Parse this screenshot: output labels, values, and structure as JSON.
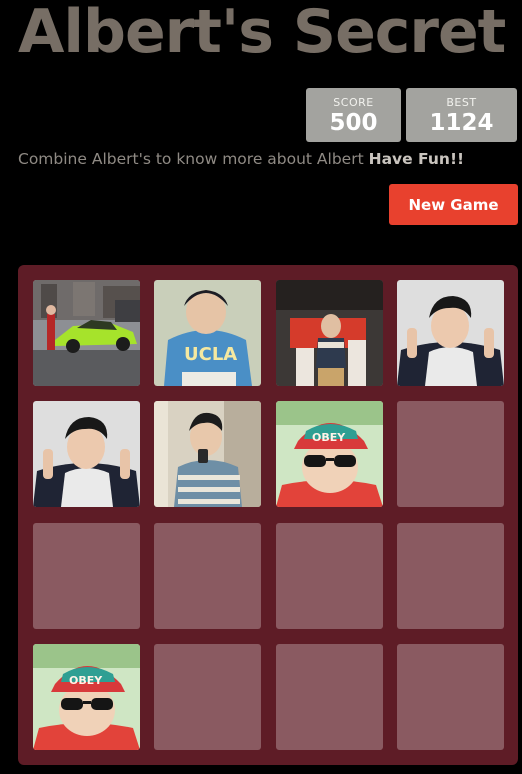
{
  "header": {
    "title": "Albert's Secret"
  },
  "scores": {
    "score_label": "SCORE",
    "score_value": "500",
    "best_label": "BEST",
    "best_value": "1124"
  },
  "intro": {
    "text": "Combine Albert's to know more about Albert ",
    "emphasis": "Have Fun!!"
  },
  "controls": {
    "new_game_label": "New Game"
  },
  "colors": {
    "background": "#000000",
    "title": "#776e65",
    "score_box": "#a3a39f",
    "new_game_button": "#e8412e",
    "board": "#5e1c26",
    "empty_cell": "#8a5a61"
  },
  "board": {
    "size": 4,
    "rows": [
      [
        "photo-sports-car",
        "photo-ucla-hoodie",
        "photo-ted-stage",
        "photo-selfie-hoodie"
      ],
      [
        "photo-selfie-hoodie",
        "photo-mirror-selfie",
        "photo-obey-cap-sunglasses",
        "empty"
      ],
      [
        "empty",
        "empty",
        "empty",
        "empty"
      ],
      [
        "photo-obey-cap-sunglasses",
        "empty",
        "empty",
        "empty"
      ]
    ]
  }
}
